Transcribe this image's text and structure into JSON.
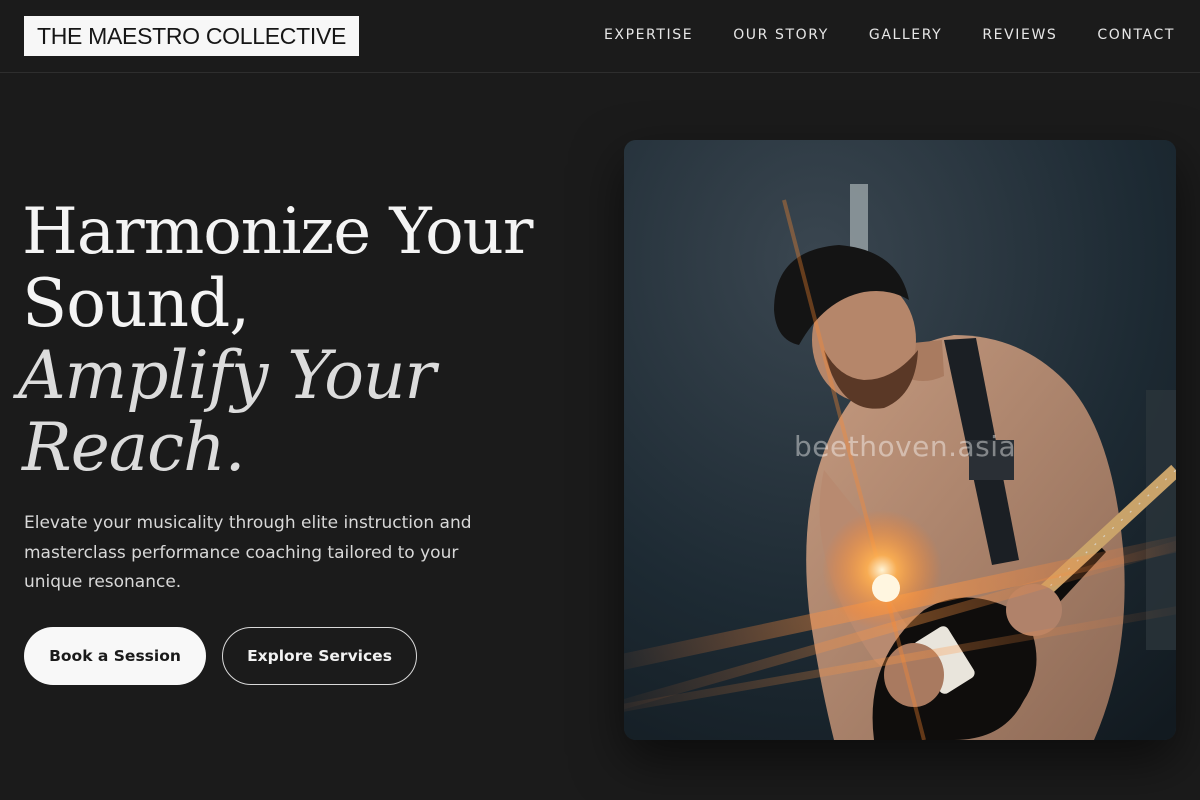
{
  "brand": {
    "name": "THE MAESTRO COLLECTIVE"
  },
  "nav": {
    "items": [
      {
        "label": "EXPERTISE"
      },
      {
        "label": "OUR STORY"
      },
      {
        "label": "GALLERY"
      },
      {
        "label": "REVIEWS"
      },
      {
        "label": "CONTACT"
      }
    ]
  },
  "hero": {
    "headline": {
      "line1": "Harmonize Your",
      "line2": "Sound,",
      "line3": "Amplify Your",
      "line4": "Reach."
    },
    "subtitle": "Elevate your musicality through elite instruction and masterclass performance coaching tailored to your unique resonance.",
    "primary_cta": "Book a Session",
    "secondary_cta": "Explore Services",
    "image": {
      "subject": "guitarist-photo",
      "watermark": "beethoven.asia"
    }
  },
  "colors": {
    "background": "#1b1b1b",
    "text": "#f2f2f2",
    "logo_bg": "#f7f7f7",
    "primary_button_bg": "#f8f8f8",
    "accent_glow": "#ff8a2a"
  }
}
